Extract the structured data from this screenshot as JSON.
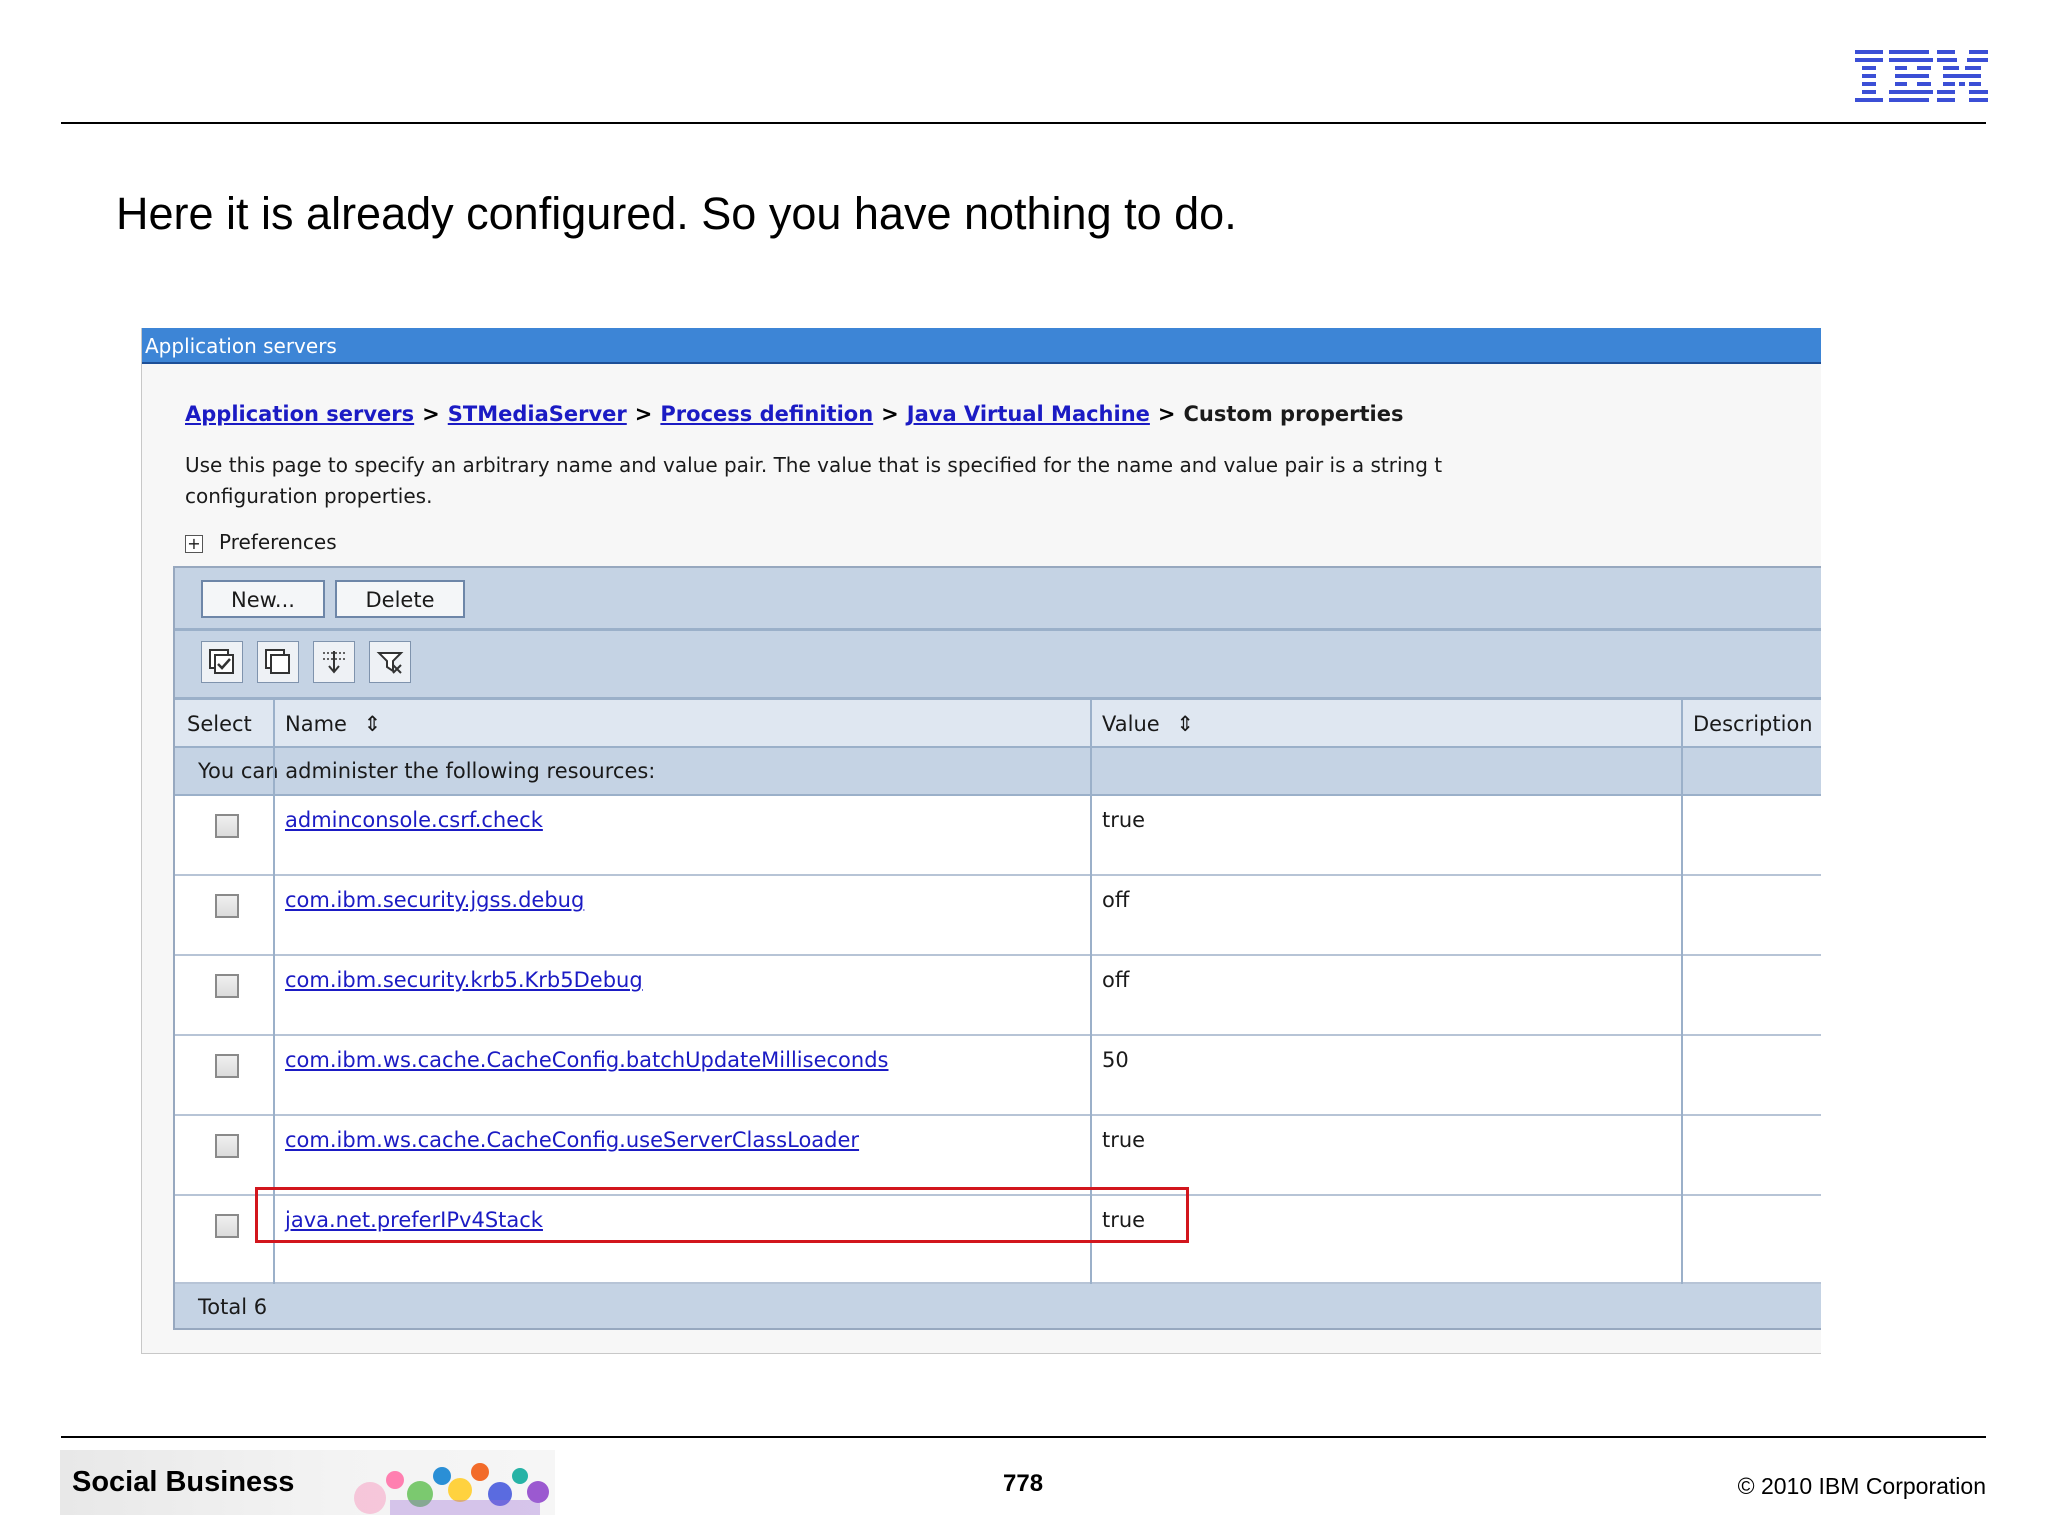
{
  "slide": {
    "title": "Here it is already configured. So you have nothing to do.",
    "logo": "IBM"
  },
  "console": {
    "window_title": "Application servers",
    "breadcrumb": {
      "links": [
        "Application servers",
        "STMediaServer",
        "Process definition",
        "Java Virtual Machine"
      ],
      "separator": ">",
      "current": "Custom properties"
    },
    "description_lines": [
      "Use this page to specify an arbitrary name and value pair. The value that is specified for the name and value pair is a string t",
      "configuration properties."
    ],
    "preferences_label": "Preferences",
    "buttons": {
      "new": "New...",
      "delete": "Delete"
    },
    "toolbar_icons": [
      "select-all-icon",
      "deselect-all-icon",
      "show-filter-icon",
      "clear-filter-icon"
    ],
    "columns": {
      "select": "Select",
      "name": "Name",
      "value": "Value",
      "description": "Description"
    },
    "resources_message": "You can administer the following resources:",
    "rows": [
      {
        "name": "adminconsole.csrf.check",
        "value": "true",
        "description": ""
      },
      {
        "name": "com.ibm.security.jgss.debug",
        "value": "off",
        "description": ""
      },
      {
        "name": "com.ibm.security.krb5.Krb5Debug",
        "value": "off",
        "description": ""
      },
      {
        "name": "com.ibm.ws.cache.CacheConfig.batchUpdateMilliseconds",
        "value": "50",
        "description": ""
      },
      {
        "name": "com.ibm.ws.cache.CacheConfig.useServerClassLoader",
        "value": "true",
        "description": ""
      },
      {
        "name": "java.net.preferIPv4Stack",
        "value": "true",
        "description": ""
      }
    ],
    "total": "Total 6",
    "highlight_color": "#d2161d"
  },
  "footer": {
    "brand": "Social Business",
    "page_number": "778",
    "copyright": "© 2010 IBM Corporation"
  },
  "colors": {
    "title_bar": "#3d85d6",
    "link": "#1b1bc4",
    "table_band": "#c5d3e4",
    "ibm_blue": "#3b4fd6"
  }
}
